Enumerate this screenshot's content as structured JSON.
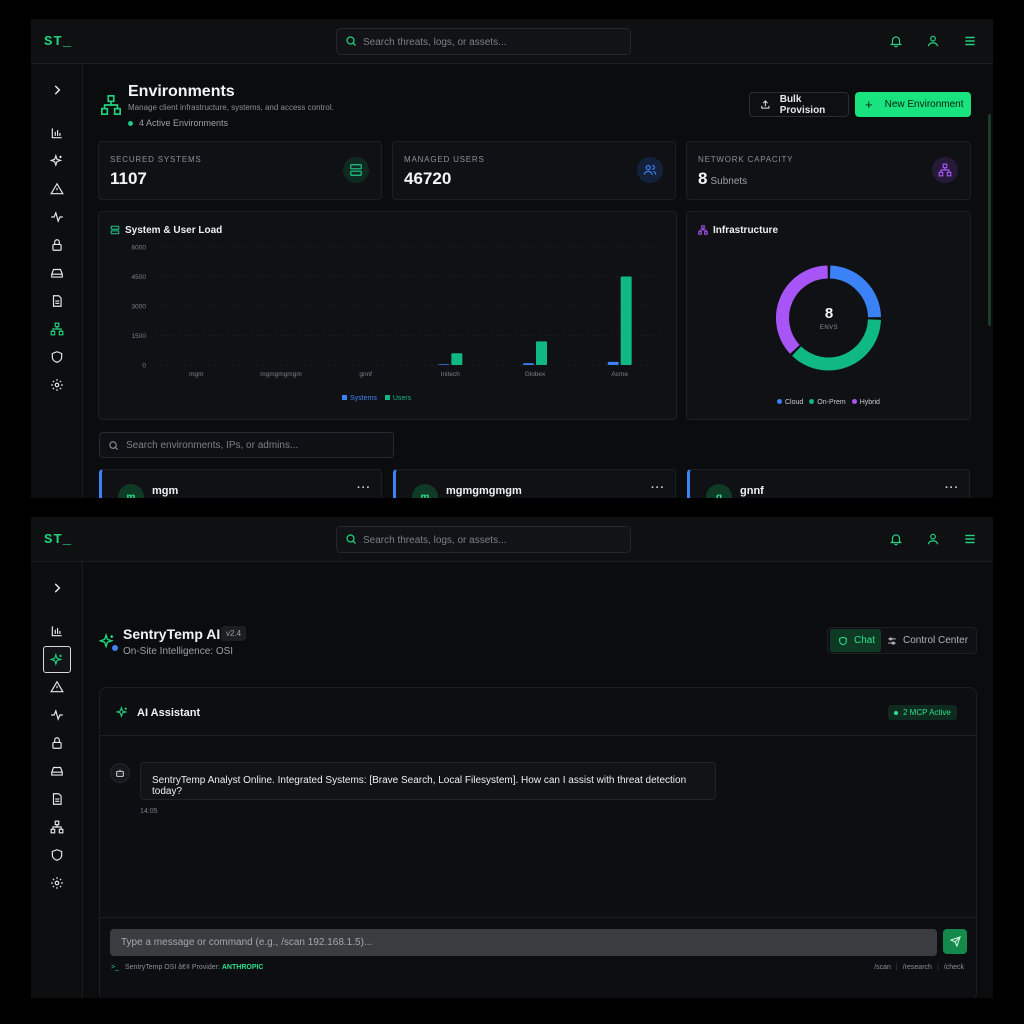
{
  "app": {
    "logo": "ST_",
    "search_placeholder": "Search threats, logs, or assets..."
  },
  "env_page": {
    "title": "Environments",
    "subtitle": "Manage client infrastructure, systems, and access control.",
    "active_count": "4 Active Environments",
    "bulk_label": "Bulk Provision",
    "new_label": "New Environment",
    "stats": [
      {
        "label": "SECURED SYSTEMS",
        "value": "1107",
        "sub": "",
        "icon": "server-icon",
        "color": "#22c98a"
      },
      {
        "label": "MANAGED USERS",
        "value": "46720",
        "sub": "",
        "icon": "users-icon",
        "color": "#3b82f6"
      },
      {
        "label": "NETWORK CAPACITY",
        "value": "8",
        "sub": "Subnets",
        "icon": "network-icon",
        "color": "#a855f7"
      }
    ],
    "load_title": "System & User Load",
    "infra_title": "Infrastructure",
    "env_search_placeholder": "Search environments, IPs, or admins...",
    "env_cards": [
      {
        "name": "mgm",
        "initial": "m"
      },
      {
        "name": "mgmgmgmgm",
        "initial": "m"
      },
      {
        "name": "gnnf",
        "initial": "g"
      }
    ]
  },
  "chart_data": [
    {
      "type": "bar",
      "title": "System & User Load",
      "categories": [
        "mgm",
        "mgmgmgmgm",
        "gnnf",
        "Initech",
        "Globex",
        "Acme"
      ],
      "series": [
        {
          "name": "Systems",
          "color": "#3b82f6",
          "values": [
            0,
            0,
            0,
            40,
            90,
            160
          ]
        },
        {
          "name": "Users",
          "color": "#10b981",
          "values": [
            0,
            0,
            0,
            600,
            1200,
            4500
          ]
        }
      ],
      "ylim": [
        0,
        6000
      ],
      "yticks": [
        "0",
        "1500",
        "3000",
        "4500",
        "6000"
      ],
      "grid": true,
      "legend": "bottom"
    },
    {
      "type": "pie",
      "title": "Infrastructure",
      "center_value": "8",
      "center_label": "ENVS",
      "labels": [
        "Cloud",
        "On-Prem",
        "Hybrid"
      ],
      "values": [
        25,
        37.5,
        37.5
      ],
      "colors": [
        "#3b82f6",
        "#10b981",
        "#a855f7"
      ],
      "legend": "bottom"
    }
  ],
  "ai_page": {
    "title": "SentryTemp AI",
    "version": "v2.4",
    "subtitle": "On-Site Intelligence: OSI",
    "tab_chat": "Chat",
    "tab_control": "Control Center",
    "assistant_title": "AI Assistant",
    "mcp_badge": "2 MCP Active",
    "message": "SentryTemp Analyst Online. Integrated Systems: [Brave Search, Local Filesystem]. How can I assist with threat detection today?",
    "message_time": "14:05",
    "input_placeholder": "Type a message or command (e.g., /scan 192.168.1.5)...",
    "footer_prefix": ">_",
    "footer_text": "SentryTemp OSI â€¢ Provider:",
    "footer_provider": "ANTHROPIC",
    "commands": [
      "/scan",
      "/research",
      "/check"
    ]
  }
}
